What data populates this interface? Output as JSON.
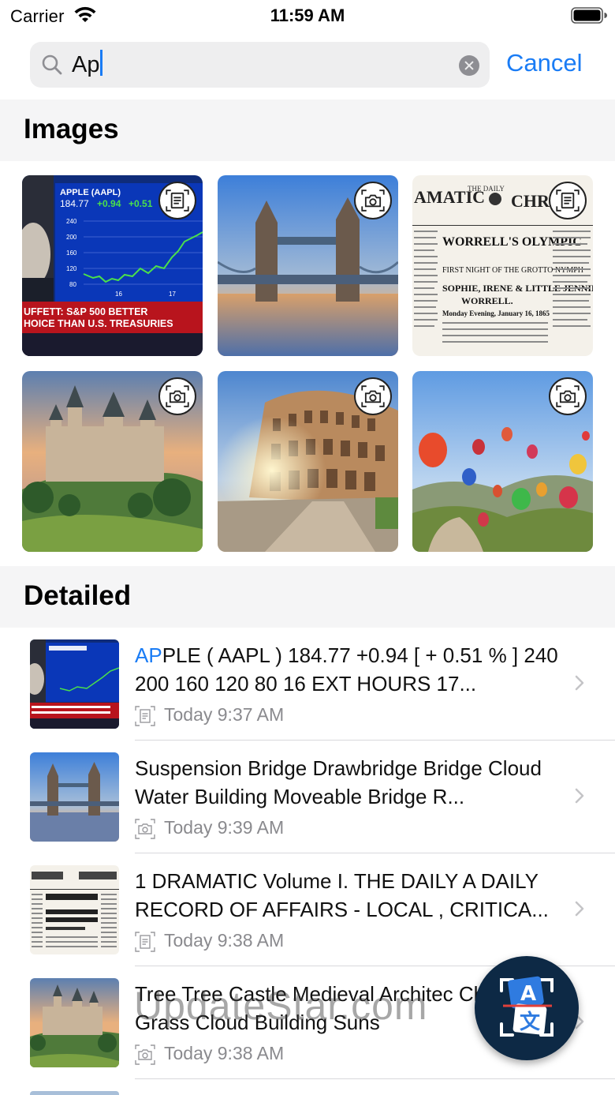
{
  "status_bar": {
    "carrier": "Carrier",
    "time": "11:59 AM"
  },
  "search": {
    "query": "Ap",
    "cancel_label": "Cancel"
  },
  "images_section": {
    "title": "Images",
    "tiles": [
      {
        "subject": "Apple stock chart screenshot",
        "badge_icon": "document-scan-icon",
        "text": [
          "APPLE (AAPL)",
          "184.77",
          "+0.94",
          "+0.51",
          "240",
          "200",
          "160",
          "120",
          "80",
          "16",
          "17",
          "UFFETT: S&P 500 BETTER",
          "HOICE THAN U.S. TREASURIES"
        ]
      },
      {
        "subject": "Tower Bridge at sunset",
        "badge_icon": "camera-scan-icon"
      },
      {
        "subject": "Vintage newspaper page",
        "badge_icon": "document-scan-icon",
        "text": [
          "AMATIC",
          "CHR",
          "THE DAILY",
          "WORRELL'S OLYMPIC",
          "FIRST NIGHT OF THE GROTTO NYMPH",
          "SOPHIE, IRENE & LITTLE JENNIE",
          "WORRELL.",
          "Monday Evening, January 16, 1865"
        ]
      },
      {
        "subject": "Medieval castle on hill",
        "badge_icon": "camera-scan-icon"
      },
      {
        "subject": "Colosseum at sunrise",
        "badge_icon": "camera-scan-icon"
      },
      {
        "subject": "Hot air balloons over valley",
        "badge_icon": "camera-scan-icon"
      }
    ]
  },
  "detailed_section": {
    "title": "Detailed",
    "items": [
      {
        "title_highlight": "AP",
        "title_rest": "PLE ( AAPL ) 184.77 +0.94 [ + 0.51 % ] 240 200 160 120 80 16 EXT HOURS 17...",
        "time": "Today 9:37 AM",
        "type_icon": "document-scan-icon",
        "thumb": "stock-chart"
      },
      {
        "title_highlight": "",
        "title_rest": "Suspension Bridge Drawbridge Bridge Cloud Water Building Moveable Bridge R...",
        "time": "Today 9:39 AM",
        "type_icon": "camera-scan-icon",
        "thumb": "tower-bridge"
      },
      {
        "title_highlight": "",
        "title_rest": "1 DRAMATIC Volume I. THE DAILY A DAILY RECORD OF AFFAIRS - LOCAL , CRITICA...",
        "time": "Today 9:38 AM",
        "type_icon": "document-scan-icon",
        "thumb": "newspaper"
      },
      {
        "title_highlight": "",
        "title_rest": "Tree Tree Castle Medieval Architec Chateau Grass Cloud Building Suns",
        "time": "Today 9:38 AM",
        "type_icon": "camera-scan-icon",
        "thumb": "castle"
      }
    ]
  },
  "watermark": "UpdateStar.com",
  "fab": {
    "icon": "translate-icon",
    "glyph_top": "A",
    "glyph_bottom": "文"
  },
  "colors": {
    "accent": "#1a7cf5",
    "fab": "#0d2945",
    "section_bg": "#f5f5f6"
  }
}
